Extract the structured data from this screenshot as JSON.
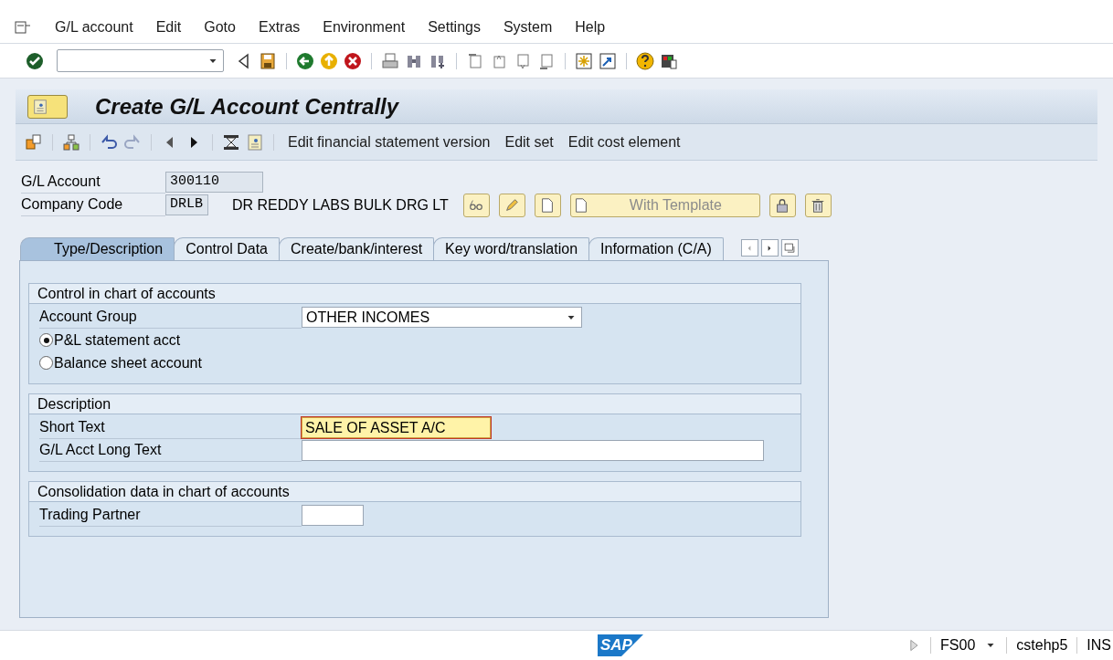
{
  "menu": [
    {
      "label": "G/L account"
    },
    {
      "label": "Edit"
    },
    {
      "label": "Goto"
    },
    {
      "label": "Extras"
    },
    {
      "label": "Environment"
    },
    {
      "label": "Settings"
    },
    {
      "label": "System"
    },
    {
      "label": "Help"
    }
  ],
  "title": "Create G/L Account Centrally",
  "app_toolbar": {
    "buttons": [
      "Edit financial statement version",
      "Edit set",
      "Edit cost element"
    ]
  },
  "header": {
    "fields": [
      {
        "label": "G/L Account",
        "value": "300110"
      },
      {
        "label": "Company Code",
        "value": "DRLB"
      }
    ],
    "company_name": "DR REDDY LABS BULK DRG LT",
    "template_button": "With Template"
  },
  "tabs": [
    {
      "label": "Type/Description",
      "selected": true
    },
    {
      "label": "Control Data",
      "selected": false
    },
    {
      "label": "Create/bank/interest",
      "selected": false
    },
    {
      "label": "Key word/translation",
      "selected": false
    },
    {
      "label": "Information (C/A)",
      "selected": false
    }
  ],
  "sections": [
    {
      "title": "Control in chart of accounts",
      "rows": [
        {
          "kind": "dropdown",
          "label": "Account Group",
          "value": "OTHER INCOMES"
        },
        {
          "kind": "radio",
          "label": "P&L statement acct",
          "selected": true
        },
        {
          "kind": "radio",
          "label": "Balance sheet account",
          "selected": false
        }
      ]
    },
    {
      "title": "Description",
      "rows": [
        {
          "kind": "input",
          "label": "Short Text",
          "value": "SALE OF ASSET A/C",
          "focused": true
        },
        {
          "kind": "input",
          "label": "G/L Acct Long Text",
          "focused": false
        }
      ]
    },
    {
      "title": "Consolidation data in chart of accounts",
      "rows": [
        {
          "kind": "input",
          "label": "Trading Partner",
          "focused": false
        }
      ]
    }
  ],
  "status_bar": {
    "logo": "SAP",
    "transaction": "FS00",
    "server": "cstehp5",
    "mode": "INS"
  }
}
